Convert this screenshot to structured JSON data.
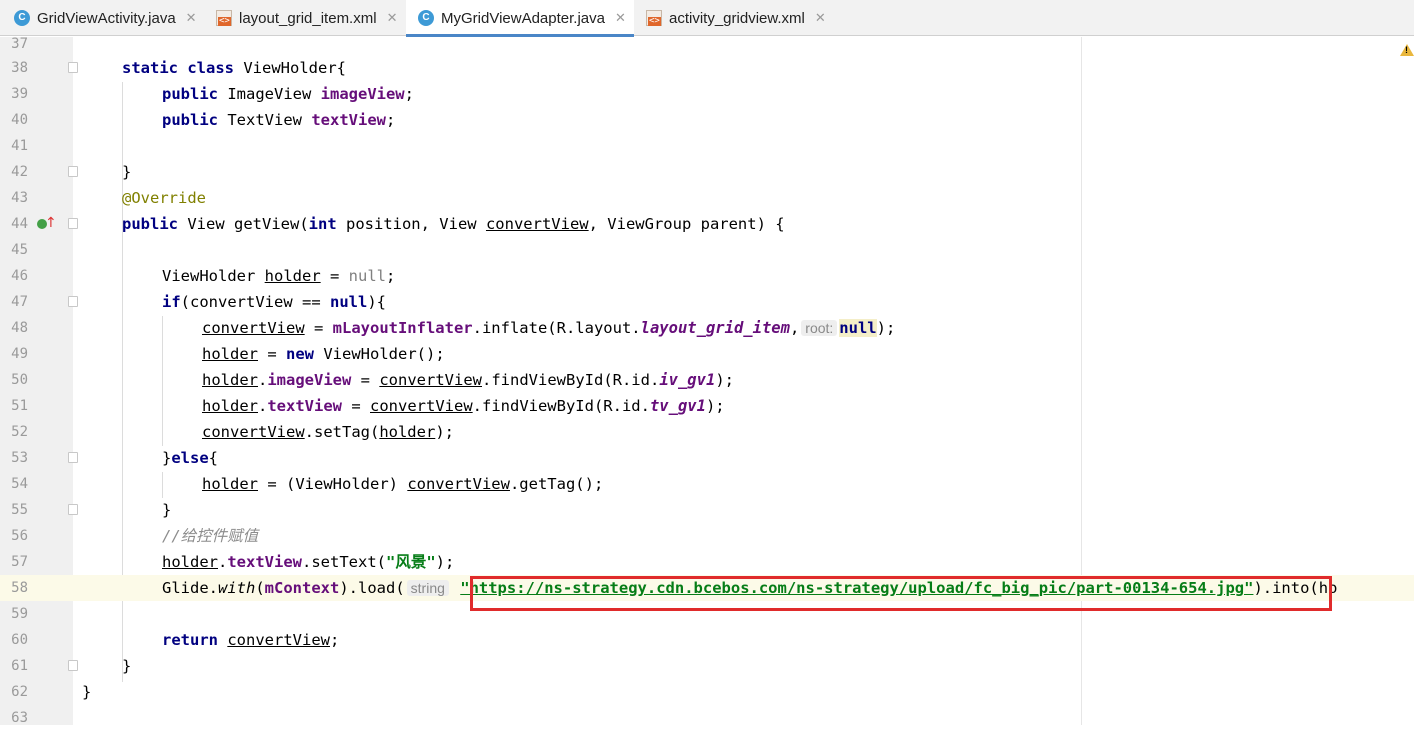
{
  "tabs": [
    {
      "label": "GridViewActivity.java",
      "type": "java"
    },
    {
      "label": "layout_grid_item.xml",
      "type": "xml"
    },
    {
      "label": "MyGridViewAdapter.java",
      "type": "java",
      "active": true
    },
    {
      "label": "activity_gridview.xml",
      "type": "xml"
    }
  ],
  "tab_close_glyph": "✕",
  "java_icon_letter": "C",
  "line_numbers": [
    "37",
    "38",
    "39",
    "40",
    "41",
    "42",
    "43",
    "44",
    "45",
    "46",
    "47",
    "48",
    "49",
    "50",
    "51",
    "52",
    "53",
    "54",
    "55",
    "56",
    "57",
    "58",
    "59",
    "60",
    "61",
    "62",
    "63"
  ],
  "code": {
    "l38": {
      "static": "static",
      "class": "class",
      "rest": " ViewHolder{"
    },
    "l39": {
      "public": "public",
      "type": " ImageView ",
      "field": "imageView",
      "semi": ";"
    },
    "l40": {
      "public": "public",
      "type": " TextView ",
      "field": "textView",
      "semi": ";"
    },
    "l42": {
      "text": "}"
    },
    "l43": {
      "annotation": "@Override"
    },
    "l44": {
      "public": "public",
      "a": " View getView(",
      "int": "int",
      "b": " position, View ",
      "convertView": "convertView",
      "c": ", ViewGroup parent) {"
    },
    "l46": {
      "a": "ViewHolder ",
      "holder": "holder",
      "b": " = ",
      "null": "null",
      "c": ";"
    },
    "l47": {
      "if": "if",
      "a": "(convertView == ",
      "null": "null",
      "b": "){"
    },
    "l48": {
      "convertView": "convertView",
      "a": " = ",
      "field": "mLayoutInflater",
      "b": ".inflate(R.layout.",
      "layout": "layout_grid_item",
      "c": ",",
      "hint": "root:",
      "null": "null",
      "d": ");"
    },
    "l49": {
      "holder": "holder",
      "a": " = ",
      "new": "new",
      "b": " ViewHolder();"
    },
    "l50": {
      "holder": "holder",
      "a": ".",
      "field": "imageView",
      "b": " = ",
      "convertView": "convertView",
      "c": ".findViewById(R.id.",
      "id": "iv_gv1",
      "d": ");"
    },
    "l51": {
      "holder": "holder",
      "a": ".",
      "field": "textView",
      "b": " = ",
      "convertView": "convertView",
      "c": ".findViewById(R.id.",
      "id": "tv_gv1",
      "d": ");"
    },
    "l52": {
      "convertView": "convertView",
      "a": ".setTag(",
      "holder": "holder",
      "b": ");"
    },
    "l53": {
      "a": "}",
      "else": "else",
      "b": "{"
    },
    "l54": {
      "holder": "holder",
      "a": " = (ViewHolder) ",
      "convertView": "convertView",
      "b": ".getTag();"
    },
    "l55": {
      "text": "}"
    },
    "l56": {
      "comment": "//给控件赋值"
    },
    "l57": {
      "holder": "holder",
      "a": ".",
      "field": "textView",
      "b": ".setText(",
      "string": "\"风景\"",
      "c": ");"
    },
    "l58": {
      "a": "Glide.",
      "with": "with",
      "b": "(",
      "field": "mContext",
      "c": ").load(",
      "hint": "string",
      "url": "\"https://ns-strategy.cdn.bcebos.com/ns-strategy/upload/fc_big_pic/part-00134-654.jpg\"",
      "d": ").into(ho"
    },
    "l60": {
      "return": "return",
      "a": " ",
      "convertView": "convertView",
      "b": ";"
    },
    "l61": {
      "text": "}"
    },
    "l62": {
      "text": "}"
    }
  },
  "colors": {
    "keyword": "#000080",
    "field": "#660e7a",
    "string": "#067d17",
    "annotation": "#808000",
    "comment": "#8c8c8c",
    "highlight_box": "#e02b2b"
  },
  "icons": {
    "gutter": "override-method-icon",
    "warning": "warning-icon"
  }
}
